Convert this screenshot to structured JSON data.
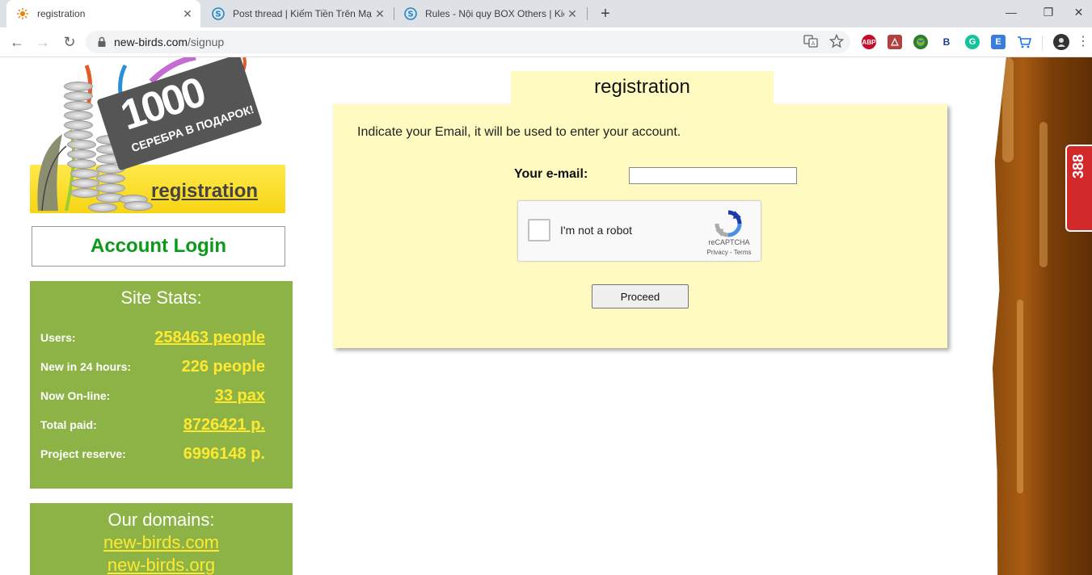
{
  "browser": {
    "tabs": [
      {
        "title": "registration",
        "active": true
      },
      {
        "title": "Post thread | Kiếm Tiền Trên Mạn",
        "active": false
      },
      {
        "title": "Rules - Nội quy BOX Others | Kiế",
        "active": false
      }
    ],
    "url_host": "new-birds.com",
    "url_path": "/signup",
    "extensions": [
      {
        "name": "abp-icon",
        "label": "ABP",
        "color": "#c70d2c"
      },
      {
        "name": "pdf-icon",
        "label": "",
        "color": "#b0413e"
      },
      {
        "name": "globe-icon",
        "label": "",
        "color": "#2e7d32"
      },
      {
        "name": "b-icon",
        "label": "B",
        "color": "#1a3d8f"
      },
      {
        "name": "grammarly-icon",
        "label": "G",
        "color": "#15c39a"
      },
      {
        "name": "e-icon",
        "label": "E",
        "color": "#3b7ddd"
      },
      {
        "name": "cart-icon",
        "label": "",
        "color": "#1a73e8"
      }
    ]
  },
  "promo": {
    "number": "1000",
    "subtitle": "СЕРЕБРА В ПОДАРОК!",
    "registration_link": "registration"
  },
  "login": {
    "label": "Account Login"
  },
  "stats": {
    "title": "Site Stats:",
    "rows": [
      {
        "label": "Users:",
        "value": "258463 people",
        "link": true
      },
      {
        "label": "New in 24 hours:",
        "value": "226 people",
        "link": false
      },
      {
        "label": "Now On-line:",
        "value": "33 pax",
        "link": true
      },
      {
        "label": "Total paid:",
        "value": "8726421 р.",
        "link": true
      },
      {
        "label": "Project reserve:",
        "value": "6996148 р.",
        "link": false
      }
    ]
  },
  "domains": {
    "title": "Our domains:",
    "items": [
      "new-birds.com",
      "new-birds.org"
    ]
  },
  "registration": {
    "tab_title": "registration",
    "intro": "Indicate your Email, it will be used to enter your account.",
    "email_label": "Your e-mail:",
    "email_value": "",
    "captcha_text": "I'm not a robot",
    "captcha_brand": "reCAPTCHA",
    "captcha_links": "Privacy - Terms",
    "proceed_label": "Proceed"
  },
  "side_badge": {
    "text": "388"
  },
  "colors": {
    "panel": "#fffac0",
    "stats_bg": "#8db346",
    "stats_value": "#ffe930",
    "login_text": "#0a9a18"
  }
}
